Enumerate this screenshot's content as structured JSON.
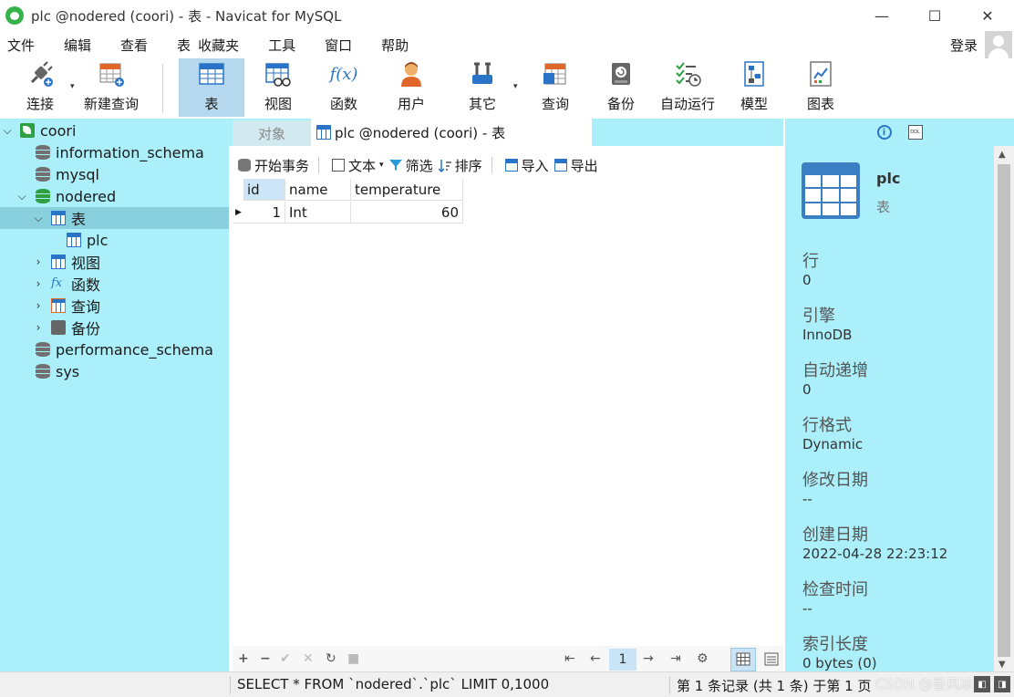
{
  "window": {
    "title": "plc @nodered (coori) - 表 - Navicat for MySQL",
    "controls": {
      "minimize": "—",
      "maximize": "☐",
      "close": "✕"
    }
  },
  "menu": {
    "items": [
      "文件",
      "编辑",
      "查看",
      "表",
      "收藏夹",
      "工具",
      "窗口",
      "帮助"
    ],
    "login": "登录"
  },
  "toolbar": {
    "connect": "连接",
    "new_query": "新建查询",
    "table": "表",
    "view": "视图",
    "function": "函数",
    "user": "用户",
    "other": "其它",
    "query": "查询",
    "backup": "备份",
    "automation": "自动运行",
    "model": "模型",
    "chart": "图表",
    "dropdown_glyph": "▾",
    "function_glyph": "f(x)"
  },
  "tree": {
    "connection": "coori",
    "items": [
      {
        "label": "information_schema"
      },
      {
        "label": "mysql"
      },
      {
        "label": "nodered"
      },
      {
        "label": "表"
      },
      {
        "label": "plc"
      },
      {
        "label": "视图"
      },
      {
        "label": "函数"
      },
      {
        "label": "查询"
      },
      {
        "label": "备份"
      },
      {
        "label": "performance_schema"
      },
      {
        "label": "sys"
      }
    ],
    "fx_glyph": "fx"
  },
  "tabs": {
    "objects": "对象",
    "active": "plc @nodered (coori) - 表"
  },
  "subtoolbar": {
    "begin_transaction": "开始事务",
    "text": "文本",
    "filter": "筛选",
    "sort": "排序",
    "import": "导入",
    "export": "导出"
  },
  "grid": {
    "columns": [
      "id",
      "name",
      "temperature"
    ],
    "rows": [
      {
        "id": "1",
        "name": "Int",
        "temperature": "60"
      }
    ]
  },
  "bottombar": {
    "add": "+",
    "remove": "−",
    "apply": "✔",
    "discard": "✕",
    "refresh": "↻",
    "stop": "■",
    "first": "⇤",
    "prev": "←",
    "page": "1",
    "next": "→",
    "last": "⇥",
    "settings": "⚙"
  },
  "info": {
    "object_name": "plc",
    "object_type": "表",
    "properties": [
      {
        "label": "行",
        "value": "0"
      },
      {
        "label": "引擎",
        "value": "InnoDB"
      },
      {
        "label": "自动递增",
        "value": "0"
      },
      {
        "label": "行格式",
        "value": "Dynamic"
      },
      {
        "label": "修改日期",
        "value": "--"
      },
      {
        "label": "创建日期",
        "value": "2022-04-28 22:23:12"
      },
      {
        "label": "检查时间",
        "value": "--"
      },
      {
        "label": "索引长度",
        "value": "0 bytes (0)"
      }
    ],
    "info_glyph": "i",
    "ddl_glyph": "DDL"
  },
  "status": {
    "query": "SELECT * FROM `nodered`.`plc` LIMIT 0,1000",
    "record": "第 1 条记录 (共 1 条) 于第 1 页",
    "watermark": "CSDN @香风冰约"
  },
  "colors": {
    "pane_bg": "#aaeffa",
    "selection": "#89d0de",
    "toolbar_active": "#b6d8ee"
  }
}
